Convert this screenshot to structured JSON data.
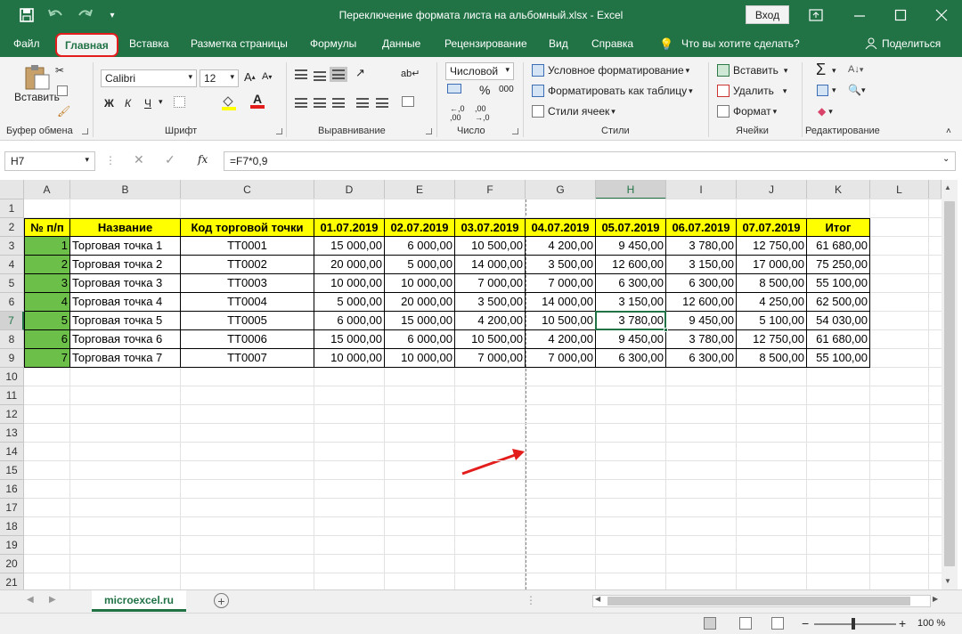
{
  "window": {
    "title": "Переключение формата листа на альбомный.xlsx  -  Excel",
    "login_label": "Вход"
  },
  "tabs": [
    "Файл",
    "Главная",
    "Вставка",
    "Разметка страницы",
    "Формулы",
    "Данные",
    "Рецензирование",
    "Вид",
    "Справка",
    "Что вы хотите сделать?",
    "Поделиться"
  ],
  "ribbon": {
    "clipboard": {
      "paste": "Вставить",
      "group": "Буфер обмена"
    },
    "font": {
      "name": "Calibri",
      "size": "12",
      "bold": "Ж",
      "italic": "К",
      "underline": "Ч",
      "color_letter": "A",
      "group": "Шрифт"
    },
    "alignment": {
      "group": "Выравнивание"
    },
    "number": {
      "format": "Числовой",
      "percent": "%",
      "thousands": "000",
      "group": "Число"
    },
    "styles": {
      "conditional": "Условное форматирование",
      "as_table": "Форматировать как таблицу",
      "cell_styles": "Стили ячеек",
      "group": "Стили"
    },
    "cells": {
      "insert": "Вставить",
      "delete": "Удалить",
      "format": "Формат",
      "group": "Ячейки"
    },
    "editing": {
      "group": "Редактирование"
    }
  },
  "formula_bar": {
    "cell_ref": "H7",
    "fx": "fx",
    "formula": "=F7*0,9"
  },
  "columns": [
    "A",
    "B",
    "C",
    "D",
    "E",
    "F",
    "G",
    "H",
    "I",
    "J",
    "K",
    "L"
  ],
  "rows": [
    "1",
    "2",
    "3",
    "4",
    "5",
    "6",
    "7",
    "8",
    "9",
    "10",
    "11",
    "12",
    "13",
    "14",
    "15",
    "16",
    "17",
    "18",
    "19",
    "20",
    "21"
  ],
  "table": {
    "headers": [
      "№ п/п",
      "Название",
      "Код торговой точки",
      "01.07.2019",
      "02.07.2019",
      "03.07.2019",
      "04.07.2019",
      "05.07.2019",
      "06.07.2019",
      "07.07.2019",
      "Итог"
    ],
    "rows": [
      [
        "1",
        "Торговая точка 1",
        "ТТ0001",
        "15 000,00",
        "6 000,00",
        "10 500,00",
        "4 200,00",
        "9 450,00",
        "3 780,00",
        "12 750,00",
        "61 680,00"
      ],
      [
        "2",
        "Торговая точка 2",
        "ТТ0002",
        "20 000,00",
        "5 000,00",
        "14 000,00",
        "3 500,00",
        "12 600,00",
        "3 150,00",
        "17 000,00",
        "75 250,00"
      ],
      [
        "3",
        "Торговая точка 3",
        "ТТ0003",
        "10 000,00",
        "10 000,00",
        "7 000,00",
        "7 000,00",
        "6 300,00",
        "6 300,00",
        "8 500,00",
        "55 100,00"
      ],
      [
        "4",
        "Торговая точка 4",
        "ТТ0004",
        "5 000,00",
        "20 000,00",
        "3 500,00",
        "14 000,00",
        "3 150,00",
        "12 600,00",
        "4 250,00",
        "62 500,00"
      ],
      [
        "5",
        "Торговая точка 5",
        "ТТ0005",
        "6 000,00",
        "15 000,00",
        "4 200,00",
        "10 500,00",
        "3 780,00",
        "9 450,00",
        "5 100,00",
        "54 030,00"
      ],
      [
        "6",
        "Торговая точка 6",
        "ТТ0006",
        "15 000,00",
        "6 000,00",
        "10 500,00",
        "4 200,00",
        "9 450,00",
        "3 780,00",
        "12 750,00",
        "61 680,00"
      ],
      [
        "7",
        "Торговая точка 7",
        "ТТ0007",
        "10 000,00",
        "10 000,00",
        "7 000,00",
        "7 000,00",
        "6 300,00",
        "6 300,00",
        "8 500,00",
        "55 100,00"
      ]
    ]
  },
  "sheet_tab": "microexcel.ru",
  "status": {
    "zoom": "100 %"
  },
  "colors": {
    "excel_green": "#217346",
    "header_fill": "#ffff00",
    "num_fill": "#6cc04a",
    "highlight": "#e31c1c"
  }
}
